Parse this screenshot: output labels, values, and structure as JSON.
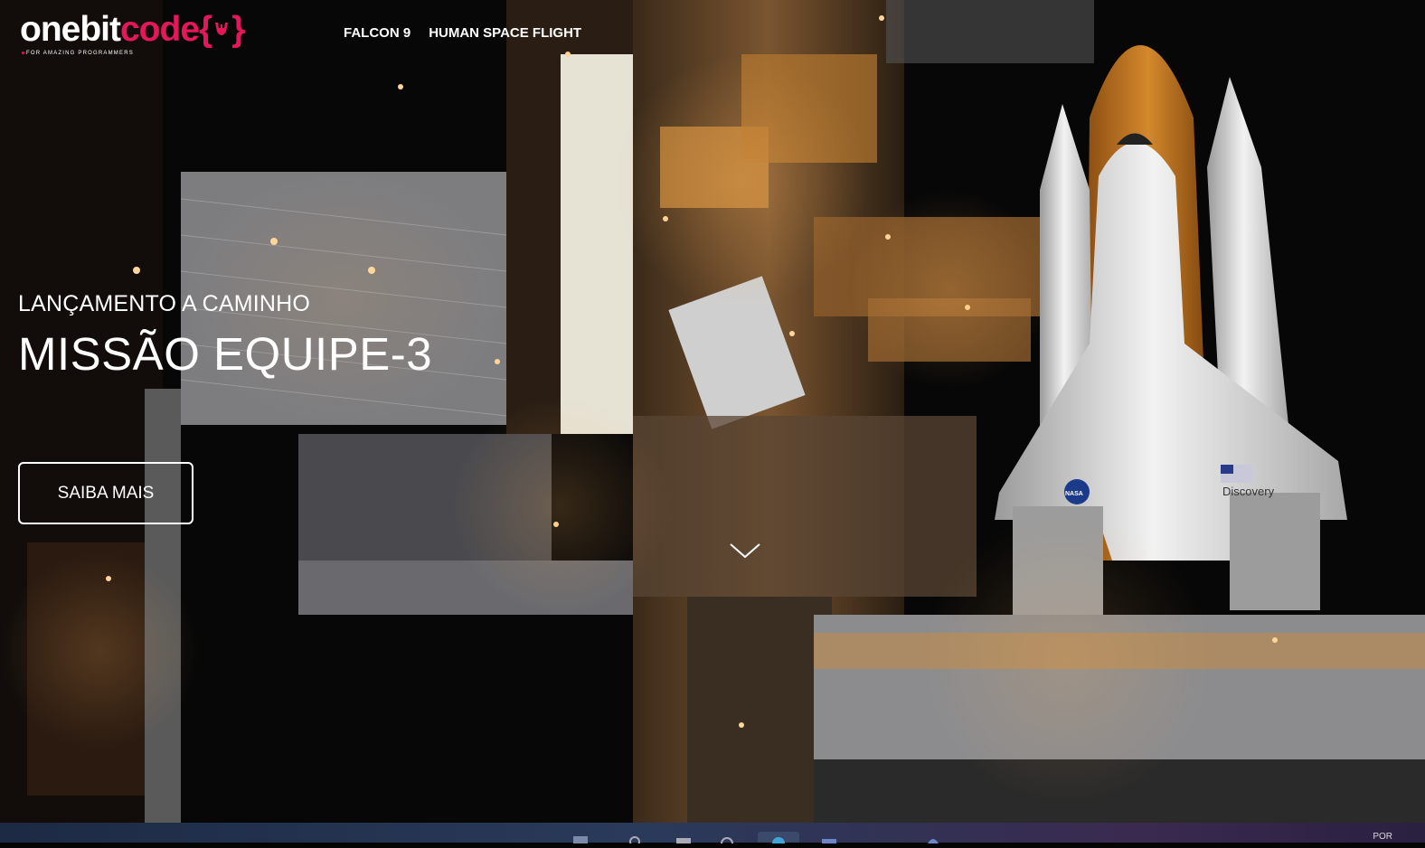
{
  "brand": {
    "name_part1": "onebit",
    "name_part2": "code",
    "braces_open": "{",
    "braces_close": "}",
    "tagline": "FOR AMAZING PROGRAMMERS"
  },
  "nav": {
    "items": [
      {
        "label": "FALCON 9"
      },
      {
        "label": "HUMAN SPACE FLIGHT"
      }
    ]
  },
  "hero": {
    "subtitle": "LANÇAMENTO A CAMINHO",
    "title": "MISSÃO EQUIPE-3",
    "cta_label": "SAIBA MAIS",
    "orbiter_name": "Discovery",
    "agency_badge": "NASA"
  },
  "taskbar": {
    "tray_text": "POR"
  },
  "colors": {
    "brand_accent": "#e5175b",
    "text": "#ffffff",
    "background": "#050505"
  }
}
